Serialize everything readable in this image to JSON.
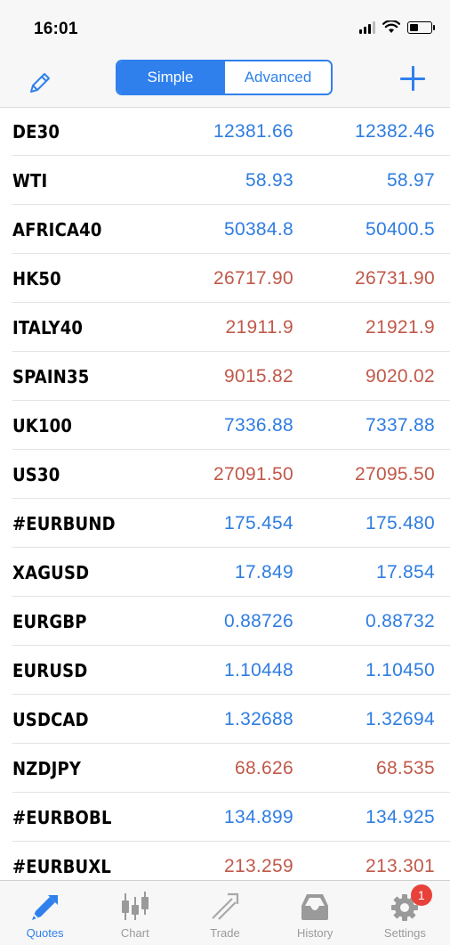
{
  "status_bar": {
    "time": "16:01"
  },
  "nav": {
    "segments": {
      "simple": "Simple",
      "advanced": "Advanced"
    },
    "active_segment": "simple",
    "accent_color": "#2f80ed"
  },
  "colors": {
    "up": "#2f7de1",
    "down": "#c0594a"
  },
  "quotes": [
    {
      "symbol": "DE30",
      "bid": "12381.66",
      "ask": "12382.46",
      "dir": "up"
    },
    {
      "symbol": "WTI",
      "bid": "58.93",
      "ask": "58.97",
      "dir": "up"
    },
    {
      "symbol": "AFRICA40",
      "bid": "50384.8",
      "ask": "50400.5",
      "dir": "up"
    },
    {
      "symbol": "HK50",
      "bid": "26717.90",
      "ask": "26731.90",
      "dir": "down"
    },
    {
      "symbol": "ITALY40",
      "bid": "21911.9",
      "ask": "21921.9",
      "dir": "down"
    },
    {
      "symbol": "SPAIN35",
      "bid": "9015.82",
      "ask": "9020.02",
      "dir": "down"
    },
    {
      "symbol": "UK100",
      "bid": "7336.88",
      "ask": "7337.88",
      "dir": "up"
    },
    {
      "symbol": "US30",
      "bid": "27091.50",
      "ask": "27095.50",
      "dir": "down"
    },
    {
      "symbol": "#EURBUND",
      "bid": "175.454",
      "ask": "175.480",
      "dir": "up"
    },
    {
      "symbol": "XAGUSD",
      "bid": "17.849",
      "ask": "17.854",
      "dir": "up"
    },
    {
      "symbol": "EURGBP",
      "bid": "0.88726",
      "ask": "0.88732",
      "dir": "up"
    },
    {
      "symbol": "EURUSD",
      "bid": "1.10448",
      "ask": "1.10450",
      "dir": "up"
    },
    {
      "symbol": "USDCAD",
      "bid": "1.32688",
      "ask": "1.32694",
      "dir": "up"
    },
    {
      "symbol": "NZDJPY",
      "bid": "68.626",
      "ask": "68.535",
      "dir": "down"
    },
    {
      "symbol": "#EURBOBL",
      "bid": "134.899",
      "ask": "134.925",
      "dir": "up"
    },
    {
      "symbol": "#EURBUXL",
      "bid": "213.259",
      "ask": "213.301",
      "dir": "down"
    }
  ],
  "tabs": [
    {
      "label": "Quotes",
      "icon": "quotes-icon",
      "active": true
    },
    {
      "label": "Chart",
      "icon": "chart-icon",
      "active": false
    },
    {
      "label": "Trade",
      "icon": "trade-icon",
      "active": false
    },
    {
      "label": "History",
      "icon": "history-icon",
      "active": false
    },
    {
      "label": "Settings",
      "icon": "settings-icon",
      "active": false,
      "badge": "1"
    }
  ]
}
